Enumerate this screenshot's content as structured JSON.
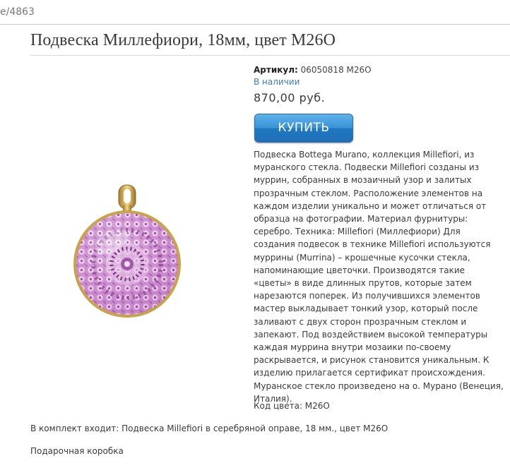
{
  "browser": {
    "url_fragment": "e/4863"
  },
  "product": {
    "title": "Подвеска Миллефиори, 18мм, цвет M26O",
    "sku_label": "Артикул:",
    "sku_value": "06050818 M26O",
    "stock": "В наличии",
    "price": "870,00 руб.",
    "buy_label": "КУПИТЬ",
    "description": "Подвеска Bottega Murano, коллекция Millefiori, из муранского стекла. Подвески Millefiori созданы из муррин, собранных в мозаичный узор и залитых прозрачным стеклом. Расположение элементов на каждом изделии уникально и может отличаться от образца на фотографии. Материал фурнитуры: серебро. Техника: Millefiori (Миллефиори) Для создания подвесок в технике Millefiori используются муррины (Murrina) – крошечные кусочки стекла, напоминающие цветочки. Производятся такие «цветы» в виде длинных прутов, которые затем нарезаются поперек. Из получившихся элементов мастер выкладывает тонкий узор, который после заливают с двух сторон прозрачным стеклом и запекают. Под воздействием высокой температуры каждая муррина внутри мозаики по-своему раскрывается, и рисунок становится уникальным. К изделию прилагается сертификат происхождения. Муранское стекло произведено на о. Мурано (Венеция, Италия).",
    "color_code": "Код цвета: M26O",
    "kit": "В комплект входит: Подвеска Millefiori в серебряной оправе, 18 мм., цвет M26O",
    "gift_box": "Подарочная коробка"
  },
  "colors": {
    "stock_link": "#3b7fb8",
    "buy_button": "#2f86cf",
    "pendant_pink": "#c77fc8",
    "pendant_rim": "#c9a34a"
  }
}
